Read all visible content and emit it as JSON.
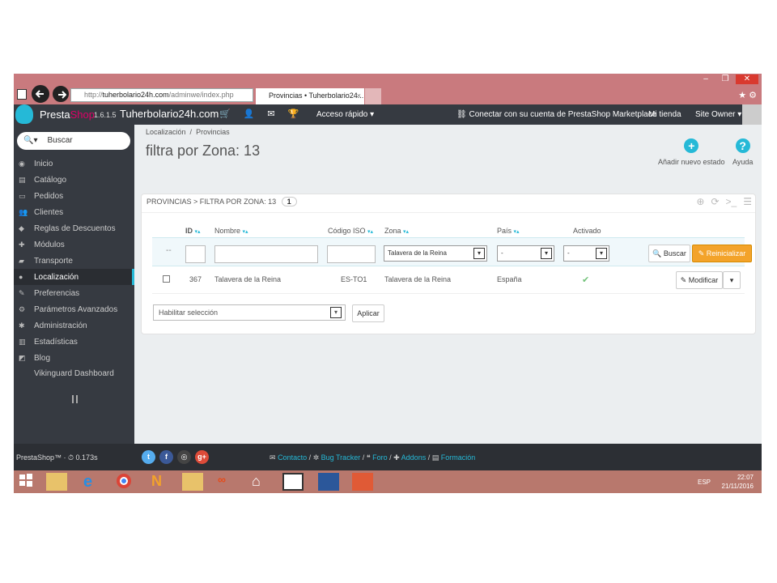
{
  "browser": {
    "url_prefix": "http://",
    "url_domain": "tuherbolario24h.com",
    "url_path": "/adminwe/index.php",
    "tab_title": "Provincias • Tuherbolario24...",
    "tab_close": "×",
    "window_min": "–",
    "window_max": "❐",
    "window_close": "✕"
  },
  "header": {
    "brand_a": "Presta",
    "brand_b": "Shop",
    "version": "1.6.1.5",
    "shop_name": "Tuherbolario24h.com",
    "quick_access": "Acceso rápido ▾",
    "connect": "Conectar con su cuenta de PrestaShop Marketplace",
    "my_store": "Mi tienda",
    "owner": "Site Owner ▾"
  },
  "sidebar": {
    "search_placeholder": "Buscar",
    "items": [
      {
        "label": "Inicio",
        "icon": "dashboard-icon"
      },
      {
        "label": "Catálogo",
        "icon": "book-icon"
      },
      {
        "label": "Pedidos",
        "icon": "credit-card-icon"
      },
      {
        "label": "Clientes",
        "icon": "users-icon"
      },
      {
        "label": "Reglas de Descuentos",
        "icon": "tag-icon"
      },
      {
        "label": "Módulos",
        "icon": "puzzle-icon"
      },
      {
        "label": "Transporte",
        "icon": "truck-icon"
      },
      {
        "label": "Localización",
        "icon": "globe-icon",
        "active": true
      },
      {
        "label": "Preferencias",
        "icon": "wrench-icon"
      },
      {
        "label": "Parámetros Avanzados",
        "icon": "cogs-icon"
      },
      {
        "label": "Administración",
        "icon": "cog-icon"
      },
      {
        "label": "Estadísticas",
        "icon": "bar-chart-icon"
      },
      {
        "label": "Blog",
        "icon": "edit-icon"
      },
      {
        "label": "Vikinguard Dashboard",
        "icon": ""
      }
    ]
  },
  "main": {
    "breadcrumb_parent": "Localización",
    "breadcrumb_sep": "/",
    "breadcrumb_current": "Provincias",
    "title": "filtra por Zona: 13",
    "add_state": "Añadir nuevo estado",
    "help": "Ayuda"
  },
  "panel": {
    "heading": "PROVINCIAS > FILTRA POR ZONA: 13",
    "count": "1",
    "columns": [
      "ID",
      "Nombre",
      "Código ISO",
      "Zona",
      "País",
      "Activado"
    ],
    "sort_arrows": "▾▴",
    "filter_zone": "Talavera de la Reina",
    "filter_country": "-",
    "filter_active": "-",
    "filter_dash": "--",
    "search_btn": "Buscar",
    "reset_btn": "Reinicializar",
    "row": {
      "id": "367",
      "name": "Talavera de la Reina",
      "iso": "ES-TO1",
      "zone": "Talavera de la Reina",
      "country": "España"
    },
    "modify_btn": "Modificar",
    "bulk_label": "Habilitar selección",
    "apply_btn": "Aplicar"
  },
  "footer": {
    "version_text": "PrestaShop™ · ⏱ 0.173s",
    "links": [
      "Contacto",
      "Bug Tracker",
      "Foro",
      "Addons",
      "Formación"
    ]
  },
  "taskbar": {
    "lang": "ESP",
    "time": "22:07",
    "date": "21/11/2016"
  },
  "colors": {
    "accent": "#25b9d7",
    "sidebar_bg": "#363a41",
    "reset_orange": "#f3a32a",
    "titlebar": "#c97a7e"
  }
}
